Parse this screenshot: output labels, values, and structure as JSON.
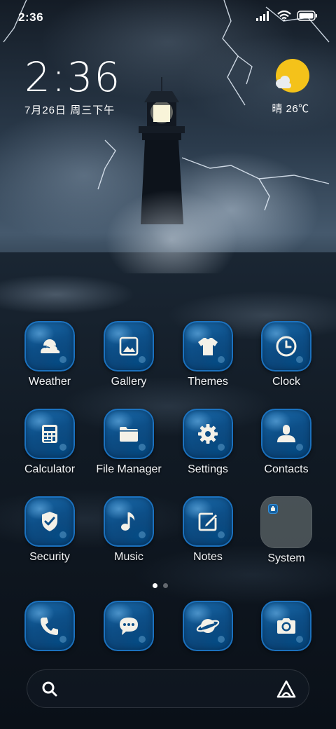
{
  "status_bar": {
    "time": "2:36",
    "icons": [
      "signal-icon",
      "wifi-icon",
      "battery-icon"
    ]
  },
  "clock_widget": {
    "time": "2:36",
    "date": "7月26日 周三下午"
  },
  "weather_widget": {
    "condition": "晴",
    "temperature": "26℃",
    "icon": "sun-cloud-icon"
  },
  "apps": [
    {
      "label": "Weather",
      "icon": "cloud-icon"
    },
    {
      "label": "Gallery",
      "icon": "image-icon"
    },
    {
      "label": "Themes",
      "icon": "tshirt-icon"
    },
    {
      "label": "Clock",
      "icon": "clock-icon"
    },
    {
      "label": "Calculator",
      "icon": "calculator-icon"
    },
    {
      "label": "File Manager",
      "icon": "folder-icon"
    },
    {
      "label": "Settings",
      "icon": "gear-icon"
    },
    {
      "label": "Contacts",
      "icon": "person-icon"
    },
    {
      "label": "Security",
      "icon": "shield-icon"
    },
    {
      "label": "Music",
      "icon": "music-note-icon"
    },
    {
      "label": "Notes",
      "icon": "edit-note-icon"
    },
    {
      "label": "System",
      "icon": "folder-group-icon"
    }
  ],
  "page_indicator": {
    "pages": 2,
    "current": 1
  },
  "dock": [
    {
      "icon": "phone-icon"
    },
    {
      "icon": "message-icon"
    },
    {
      "icon": "browser-planet-icon"
    },
    {
      "icon": "camera-icon"
    }
  ],
  "search_bar": {
    "left_icon": "search-icon",
    "right_icon": "assistant-icon"
  },
  "colors": {
    "icon_blue": "#1d6fb0",
    "icon_dark_blue": "#0a3e6e",
    "glyph": "#f4f1e8",
    "sun": "#f4c21a"
  }
}
